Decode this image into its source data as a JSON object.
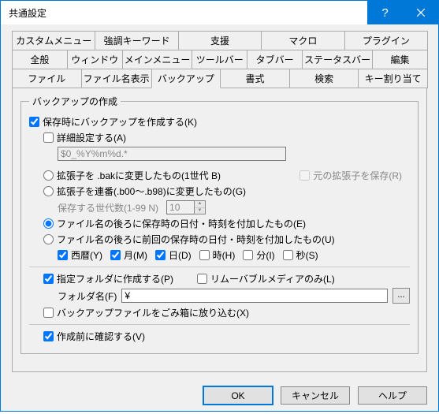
{
  "window": {
    "title": "共通設定"
  },
  "tabs": {
    "row1": [
      "カスタムメニュー",
      "強調キーワード",
      "支援",
      "マクロ",
      "プラグイン"
    ],
    "row2": [
      "全般",
      "ウィンドウ",
      "メインメニュー",
      "ツールバー",
      "タブバー",
      "ステータスバー",
      "編集"
    ],
    "row3": [
      "ファイル",
      "ファイル名表示",
      "バックアップ",
      "書式",
      "検索",
      "キー割り当て"
    ],
    "active": "バックアップ"
  },
  "group": {
    "legend": "バックアップの作成",
    "create_on_save": "保存時にバックアップを作成する(K)",
    "detail_set": "詳細設定する(A)",
    "detail_pattern": "$0_%Y%m%d.*",
    "radio_bak": "拡張子を .bakに変更したもの(1世代 B)",
    "save_orig_ext": "元の拡張子を保存(R)",
    "radio_seq": "拡張子を連番(.b00～.b98)に変更したもの(G)",
    "gen_label": "保存する世代数(1-99 N)",
    "gen_value": "10",
    "radio_save_dt": "ファイル名の後ろに保存時の日付・時刻を付加したもの(E)",
    "radio_prev_dt": "ファイル名の後ろに前回の保存時の日付・時刻を付加したもの(U)",
    "year": "西暦(Y)",
    "month": "月(M)",
    "day": "日(D)",
    "hour": "時(H)",
    "minute": "分(I)",
    "second": "秒(S)",
    "dest_folder": "指定フォルダに作成する(P)",
    "removable_only": "リムーバブルメディアのみ(L)",
    "folder_label": "フォルダ名(F)",
    "folder_value": "¥",
    "to_trash": "バックアップファイルをごみ箱に放り込む(X)",
    "confirm_before": "作成前に確認する(V)"
  },
  "buttons": {
    "ok": "OK",
    "cancel": "キャンセル",
    "help": "ヘルプ"
  }
}
